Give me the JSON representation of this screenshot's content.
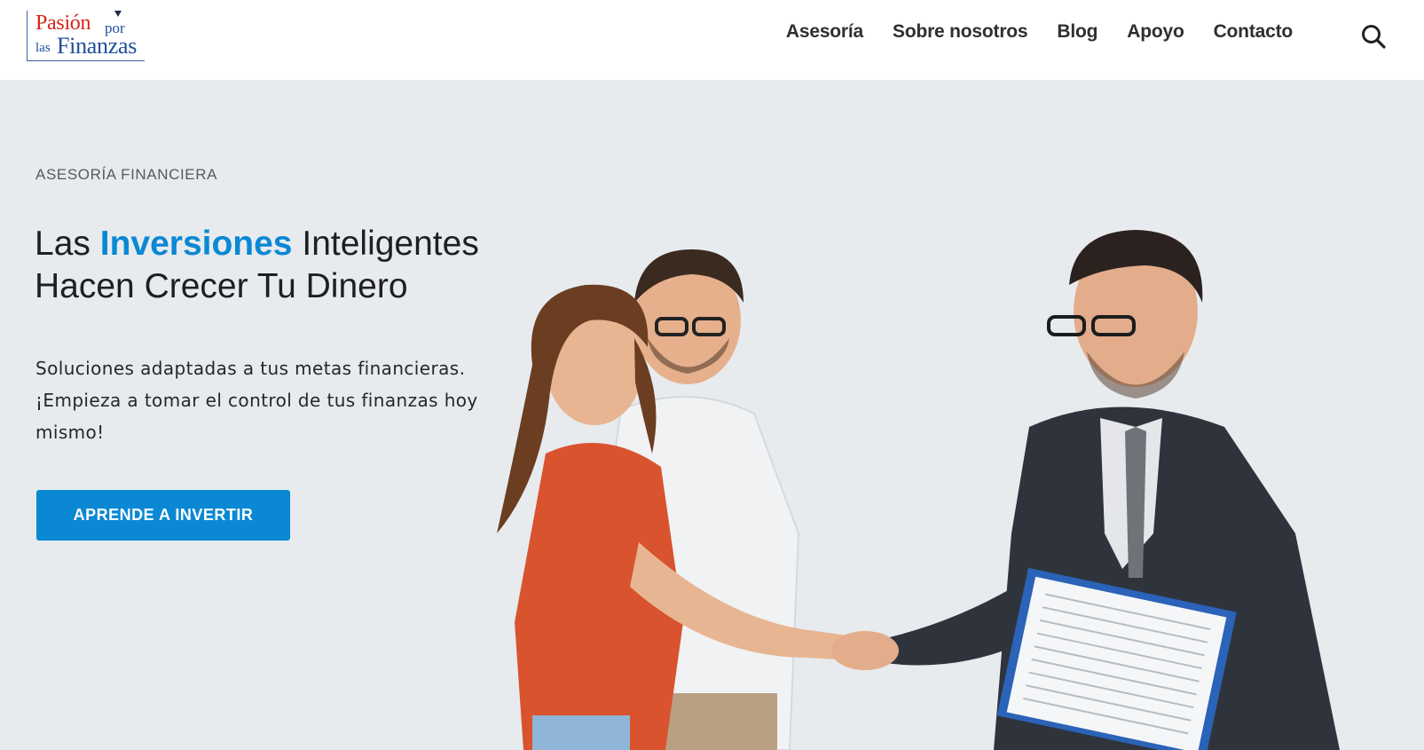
{
  "brand": {
    "logo_line1": "Pasión",
    "logo_line2": "por",
    "logo_line3": "las",
    "logo_line4": "Finanzas"
  },
  "nav": {
    "items": [
      {
        "label": "Asesoría"
      },
      {
        "label": "Sobre nosotros"
      },
      {
        "label": "Blog"
      },
      {
        "label": "Apoyo"
      },
      {
        "label": "Contacto"
      }
    ],
    "search_icon": "search-icon"
  },
  "hero": {
    "eyebrow": "ASESORÍA FINANCIERA",
    "headline_part1": "Las",
    "headline_accent": "Inversiones",
    "headline_part2": "Inteligentes Hacen Crecer Tu Dinero",
    "subtext": "Soluciones adaptadas a tus metas financieras. ¡Empieza a tomar el control de tus finanzas hoy mismo!",
    "cta_label": "APRENDE A INVERTIR"
  },
  "colors": {
    "accent": "#0a88d4",
    "hero_background": "#e7ebee",
    "logo_red": "#d8241c",
    "logo_blue": "#1f4e9c"
  }
}
